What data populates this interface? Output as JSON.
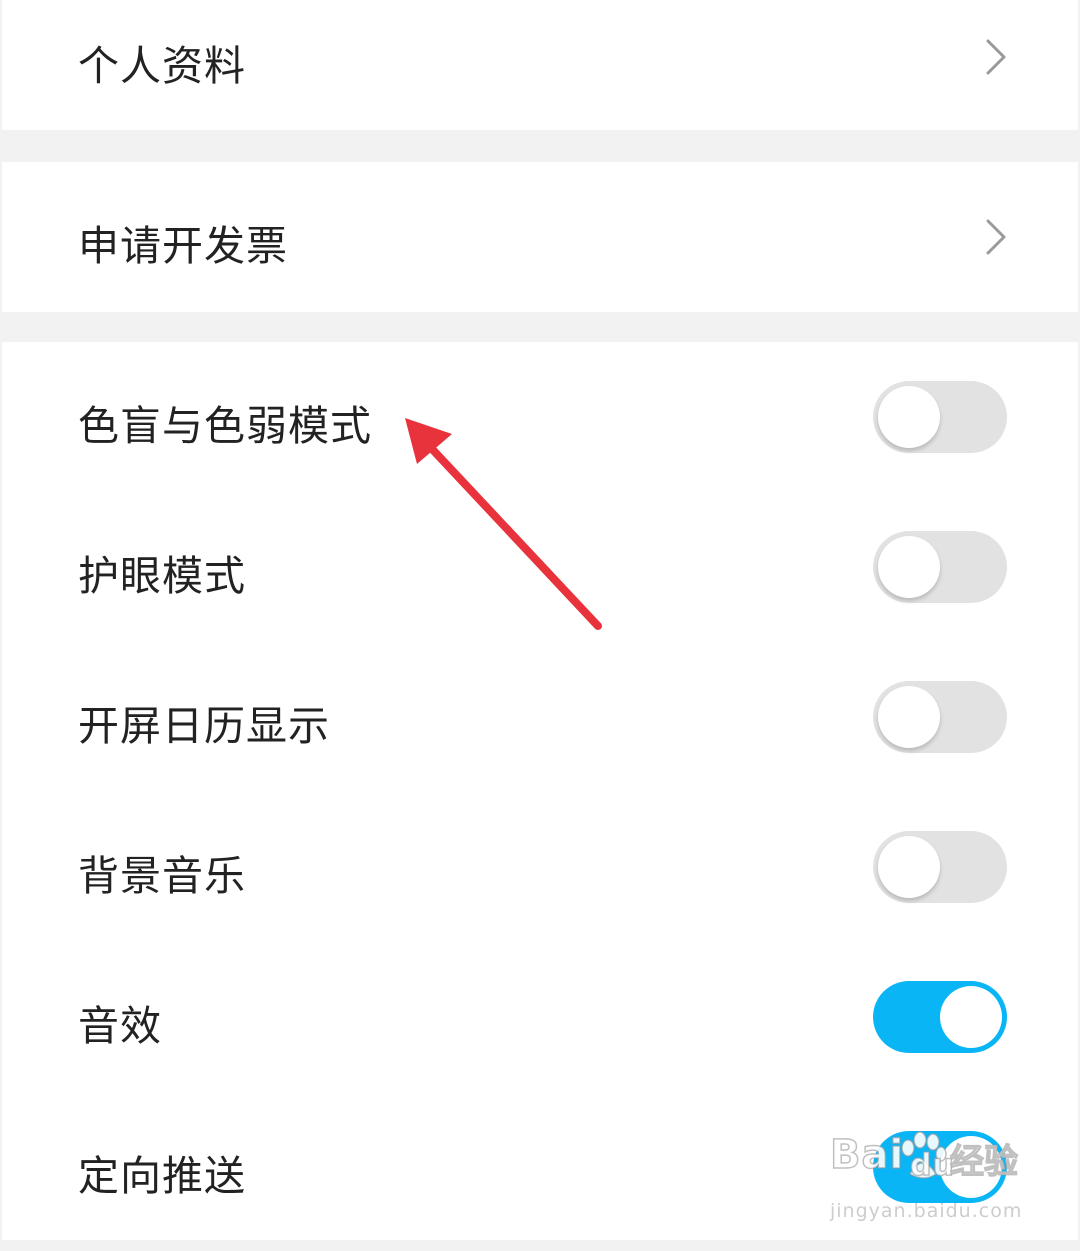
{
  "menu": {
    "profile_label": "个人资料",
    "invoice_label": "申请开发票"
  },
  "settings": [
    {
      "label": "色盲与色弱模式",
      "on": false
    },
    {
      "label": "护眼模式",
      "on": false
    },
    {
      "label": "开屏日历显示",
      "on": false
    },
    {
      "label": "背景音乐",
      "on": false
    },
    {
      "label": "音效",
      "on": true
    },
    {
      "label": "定向推送",
      "on": true
    }
  ],
  "colors": {
    "toggle_on": "#0ab5f6",
    "toggle_off": "#e2e2e2",
    "arrow": "#e8323c"
  },
  "watermark": {
    "brand": "Bai",
    "brand_suffix": "du",
    "cn": "经验",
    "url": "jingyan.baidu.com"
  }
}
